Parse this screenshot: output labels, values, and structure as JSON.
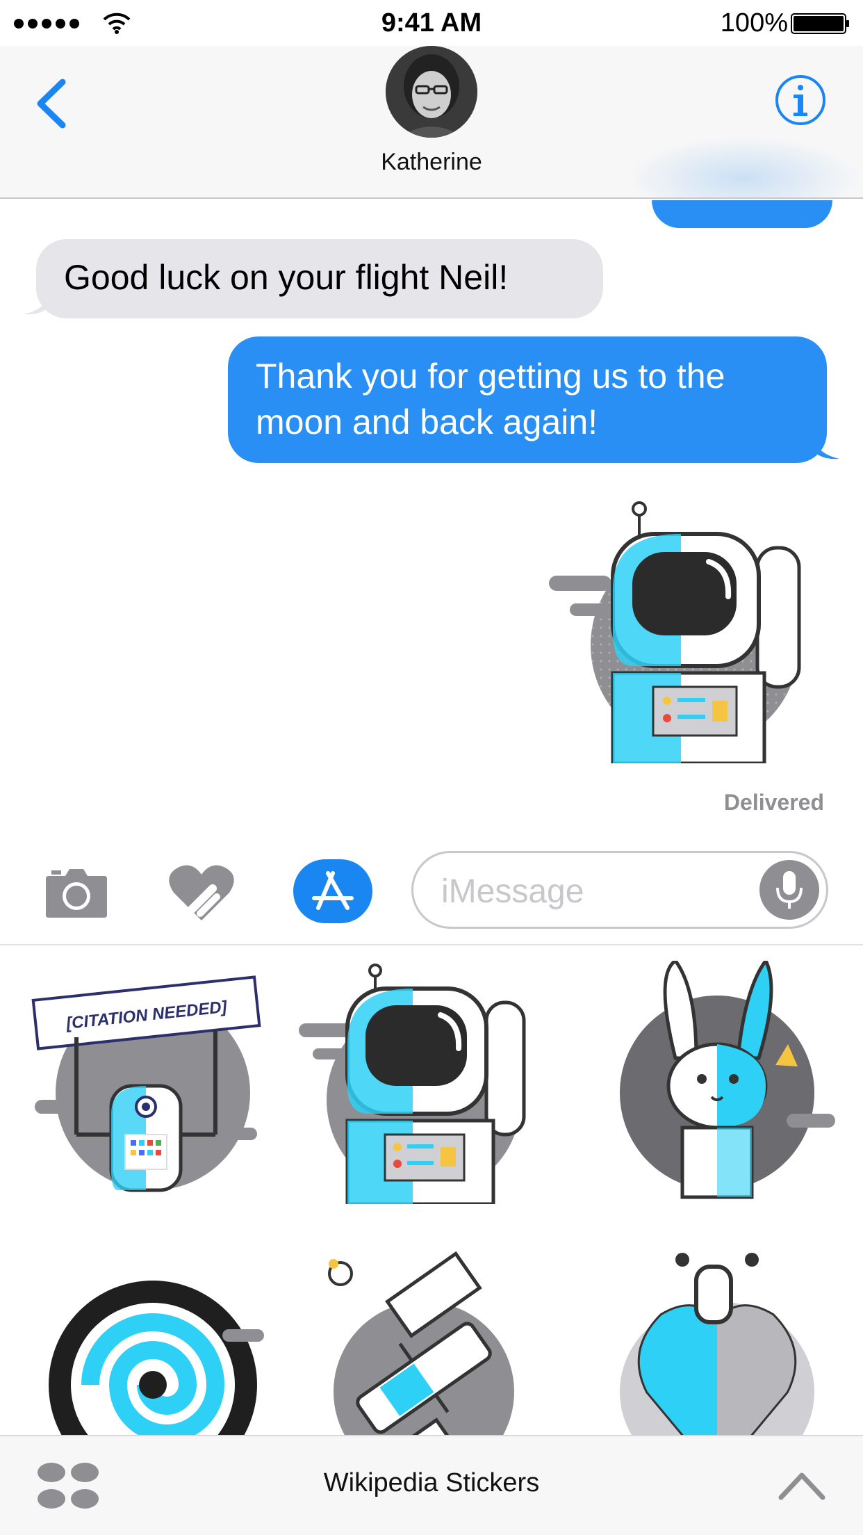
{
  "status_bar": {
    "time": "9:41 AM",
    "battery_percent": "100%",
    "signal_bars": 5,
    "battery_level": 1.0
  },
  "header": {
    "contact_name": "Katherine",
    "back_icon": "chevron-left-icon",
    "info_icon": "info-circle-icon"
  },
  "messages": [
    {
      "direction": "received",
      "text": "Good luck on your flight Neil!"
    },
    {
      "direction": "sent",
      "text_line1": "Thank you for getting us to the",
      "text_line2": "moon and back again!"
    },
    {
      "direction": "sent",
      "sticker": "astronaut-sticker"
    }
  ],
  "delivery_status": "Delivered",
  "input_bar": {
    "placeholder": "iMessage",
    "camera_icon": "camera-icon",
    "digital_touch_icon": "digital-touch-heart-icon",
    "app_store_icon": "app-store-icon",
    "mic_icon": "microphone-icon"
  },
  "stickers": {
    "citation_text": "[CITATION NEEDED]",
    "items": [
      "citation-needed-robot",
      "astronaut",
      "rabbit",
      "galaxy",
      "space-station",
      "heart"
    ]
  },
  "app_bar": {
    "title": "Wikipedia Stickers",
    "drawer_icon": "app-drawer-icon",
    "expand_icon": "chevron-up-icon"
  },
  "colors": {
    "ios_blue": "#1a86f2",
    "sent_bubble": "#2a8ff5",
    "received_bubble": "#e5e5ea",
    "sticker_cyan": "#2fd0f5",
    "sticker_gray": "#8e8e93"
  }
}
